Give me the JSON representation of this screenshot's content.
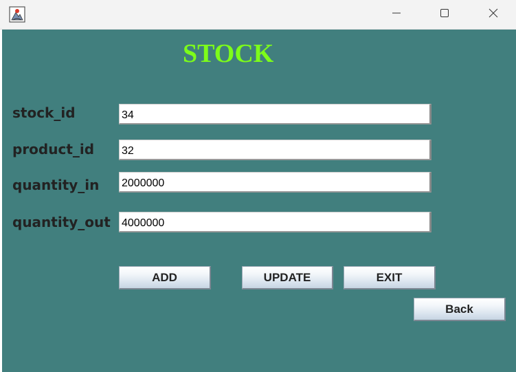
{
  "window": {
    "icon": "java-app-icon",
    "controls": {
      "minimize_icon": "minimize-icon",
      "maximize_icon": "maximize-icon",
      "close_icon": "close-icon"
    }
  },
  "colors": {
    "background": "#417f7e",
    "title": "#7dfc1a",
    "label": "#222222"
  },
  "form": {
    "title": "STOCK",
    "fields": [
      {
        "label": "stock_id",
        "value": "34"
      },
      {
        "label": "product_id",
        "value": "32"
      },
      {
        "label": "quantity_in",
        "value": "2000000"
      },
      {
        "label": "quantity_out",
        "value": "4000000"
      }
    ]
  },
  "buttons": {
    "add": "ADD",
    "update": "UPDATE",
    "exit": "EXIT",
    "back": "Back"
  }
}
